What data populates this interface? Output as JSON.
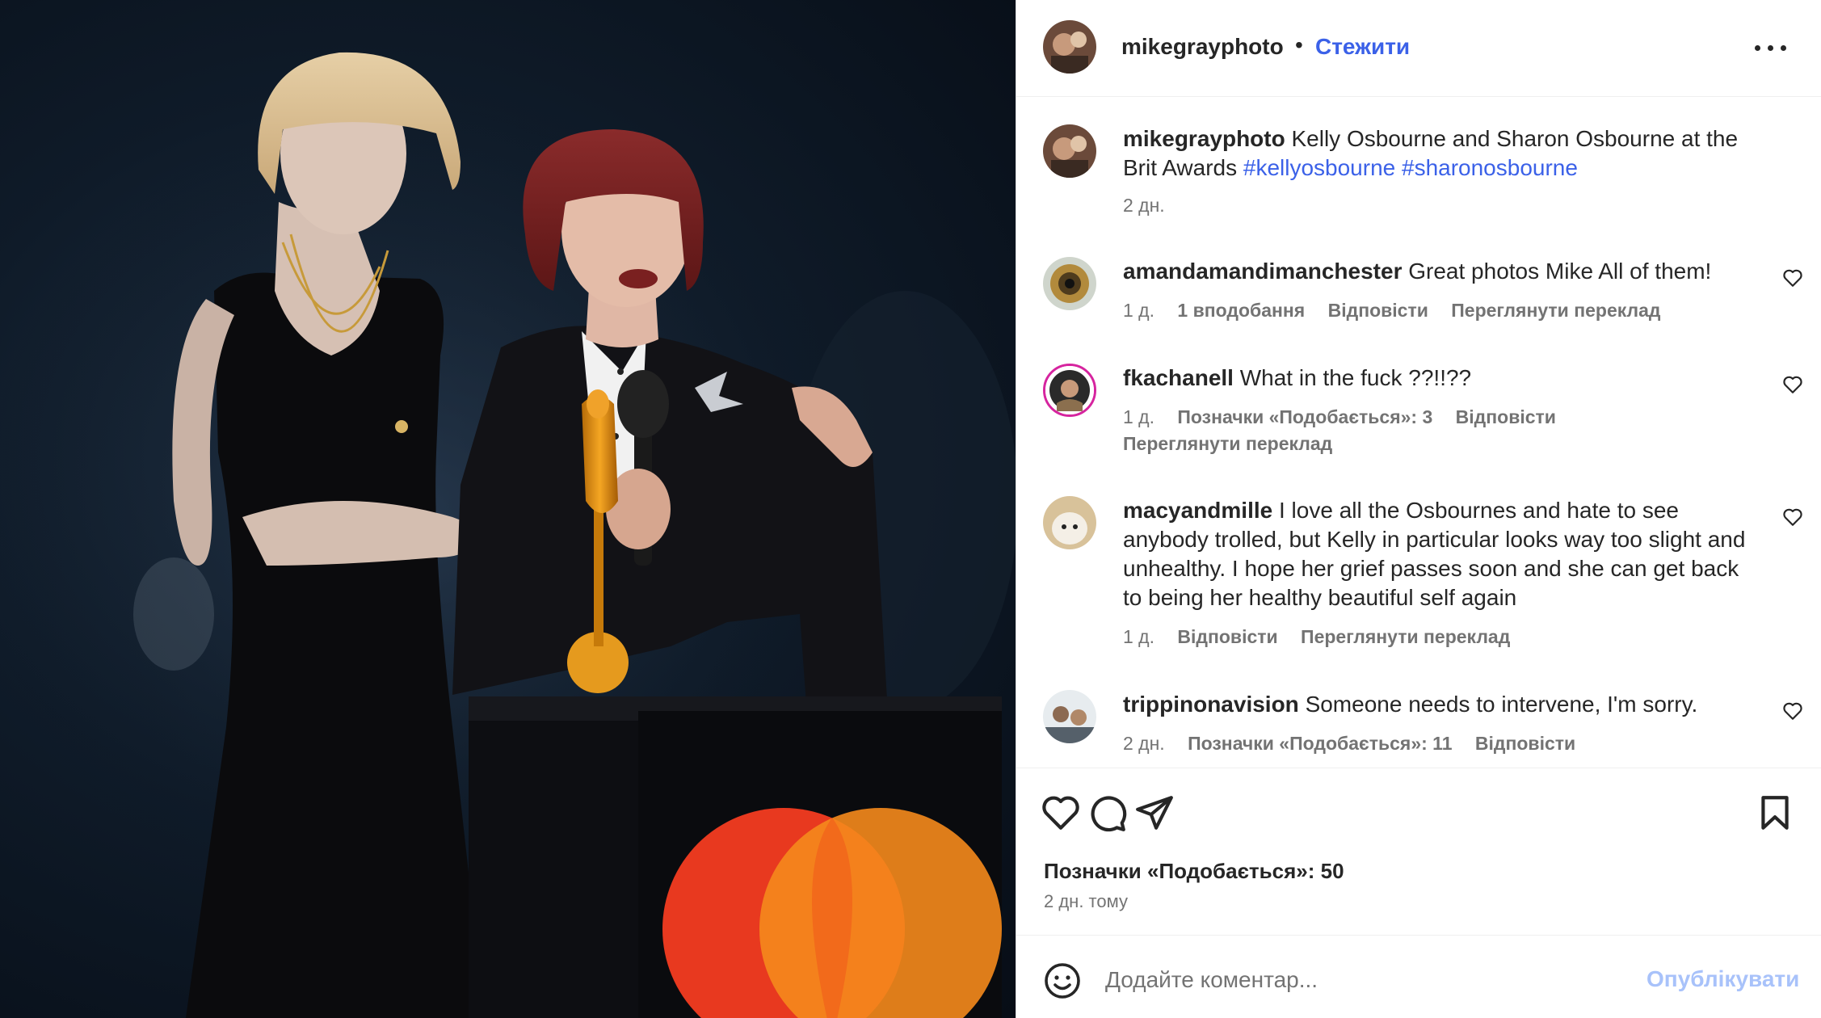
{
  "header": {
    "username": "mikegrayphoto",
    "dot": "•",
    "follow_label": "Стежити"
  },
  "caption": {
    "username": "mikegrayphoto",
    "text": "Kelly Osbourne and Sharon Osbourne at the Brit Awards",
    "hashtags": [
      "#kellyosbourne",
      "#sharonosbourne"
    ],
    "time": "2 дн."
  },
  "comments": [
    {
      "username": "amandamandimanchester",
      "text": "Great photos Mike All of them!",
      "meta": [
        "1 д.",
        "1 вподобання",
        "Відповісти",
        "Переглянути переклад"
      ]
    },
    {
      "username": "fkachanell",
      "text": "What in the fuck ??!!??",
      "meta": [
        "1 д.",
        "Позначки «Подобається»: 3",
        "Відповісти",
        "Переглянути переклад"
      ]
    },
    {
      "username": "macyandmille",
      "text": "I love all the Osbournes and hate to see anybody trolled, but Kelly in particular looks way too slight and unhealthy. I hope her grief passes soon and she can get back to being her healthy beautiful self again",
      "meta": [
        "1 д.",
        "Відповісти",
        "Переглянути переклад"
      ]
    },
    {
      "username": "trippinonavision",
      "text": "Someone needs to intervene, I'm sorry.",
      "meta": [
        "2 дн.",
        "Позначки «Подобається»: 11",
        "Відповісти"
      ]
    }
  ],
  "actions": {
    "likes": "Позначки «Подобається»: 50",
    "time": "2 дн. тому"
  },
  "composer": {
    "placeholder": "Додайте коментар...",
    "post_label": "Опублікувати"
  },
  "icons": {
    "like": "heart-icon",
    "comment": "comment-icon",
    "share": "share-icon",
    "save": "bookmark-icon",
    "emoji": "smiley-icon",
    "more": "more-icon"
  },
  "colors": {
    "link_blue": "#3b61e8",
    "post_button_disabled": "#a8c2fa",
    "meta_gray": "#737373",
    "text_dark": "#262626",
    "photo_background": "#0f1b29"
  }
}
